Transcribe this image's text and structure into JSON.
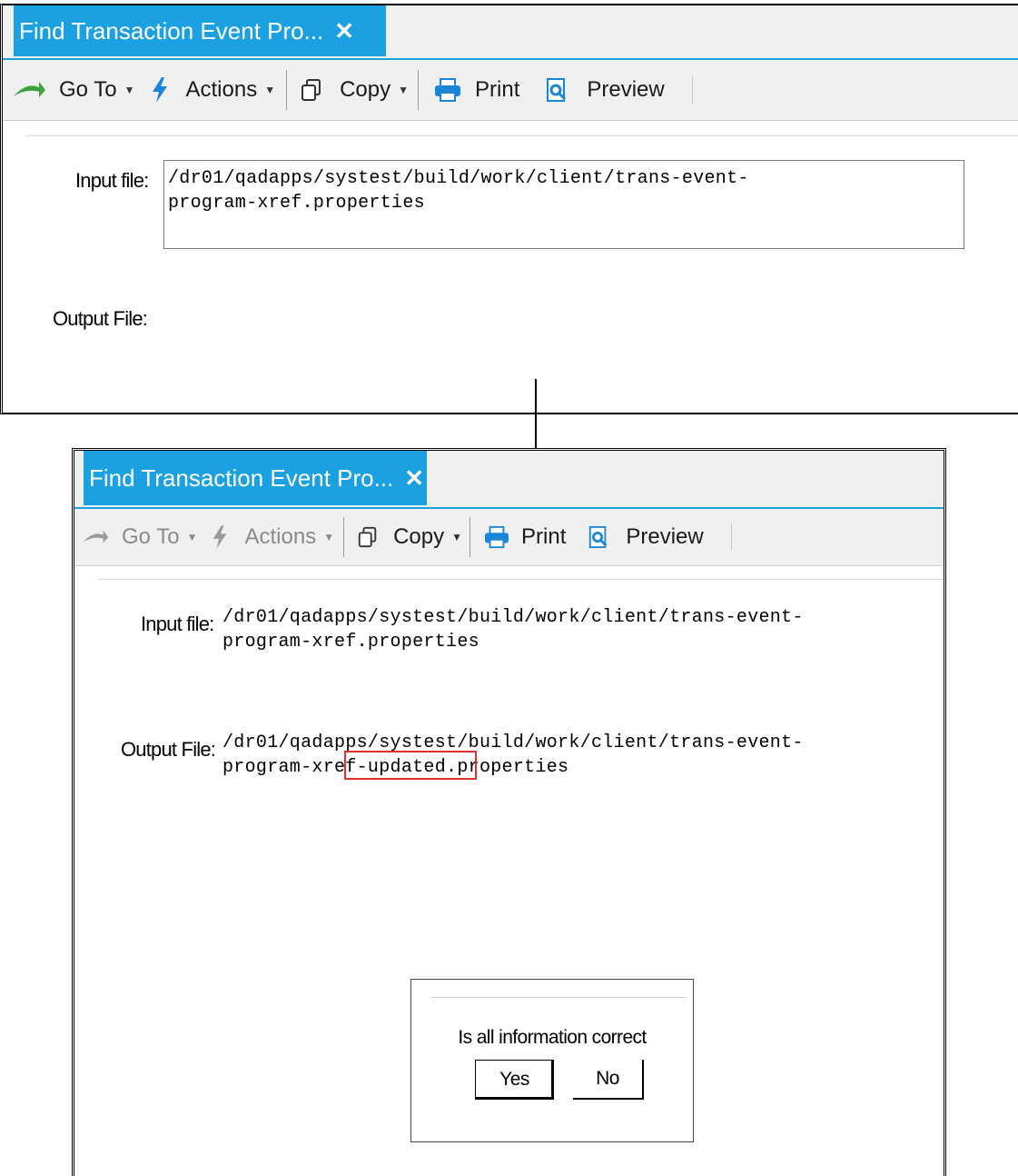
{
  "tab": {
    "title": "Find Transaction Event Pro...",
    "close": "✕"
  },
  "toolbar": {
    "goto_label": "Go To",
    "actions_label": "Actions",
    "copy_label": "Copy",
    "print_label": "Print",
    "preview_label": "Preview",
    "caret": "▼"
  },
  "before": {
    "input_label": "Input file:",
    "input_value_line1": "/dr01/qadapps/systest/build/work/client/trans-event-",
    "input_value_line2": "program-xref.properties",
    "output_label": "Output File:"
  },
  "after": {
    "input_label": "Input file:",
    "input_value_line1": "/dr01/qadapps/systest/build/work/client/trans-event-",
    "input_value_line2": "program-xref.properties",
    "output_label": "Output File:",
    "output_value_line1": "/dr01/qadapps/systest/build/work/client/trans-event-",
    "output_value_line2": "program-xref-updated.properties"
  },
  "dialog": {
    "question": "Is all information correct",
    "yes_label": "Yes",
    "no_label": "No"
  },
  "colors": {
    "tab_accent": "#1ba1e2",
    "highlight": "#e03030",
    "goto_arrow": "#3ea03e",
    "actions_bolt": "#1a86d8"
  }
}
